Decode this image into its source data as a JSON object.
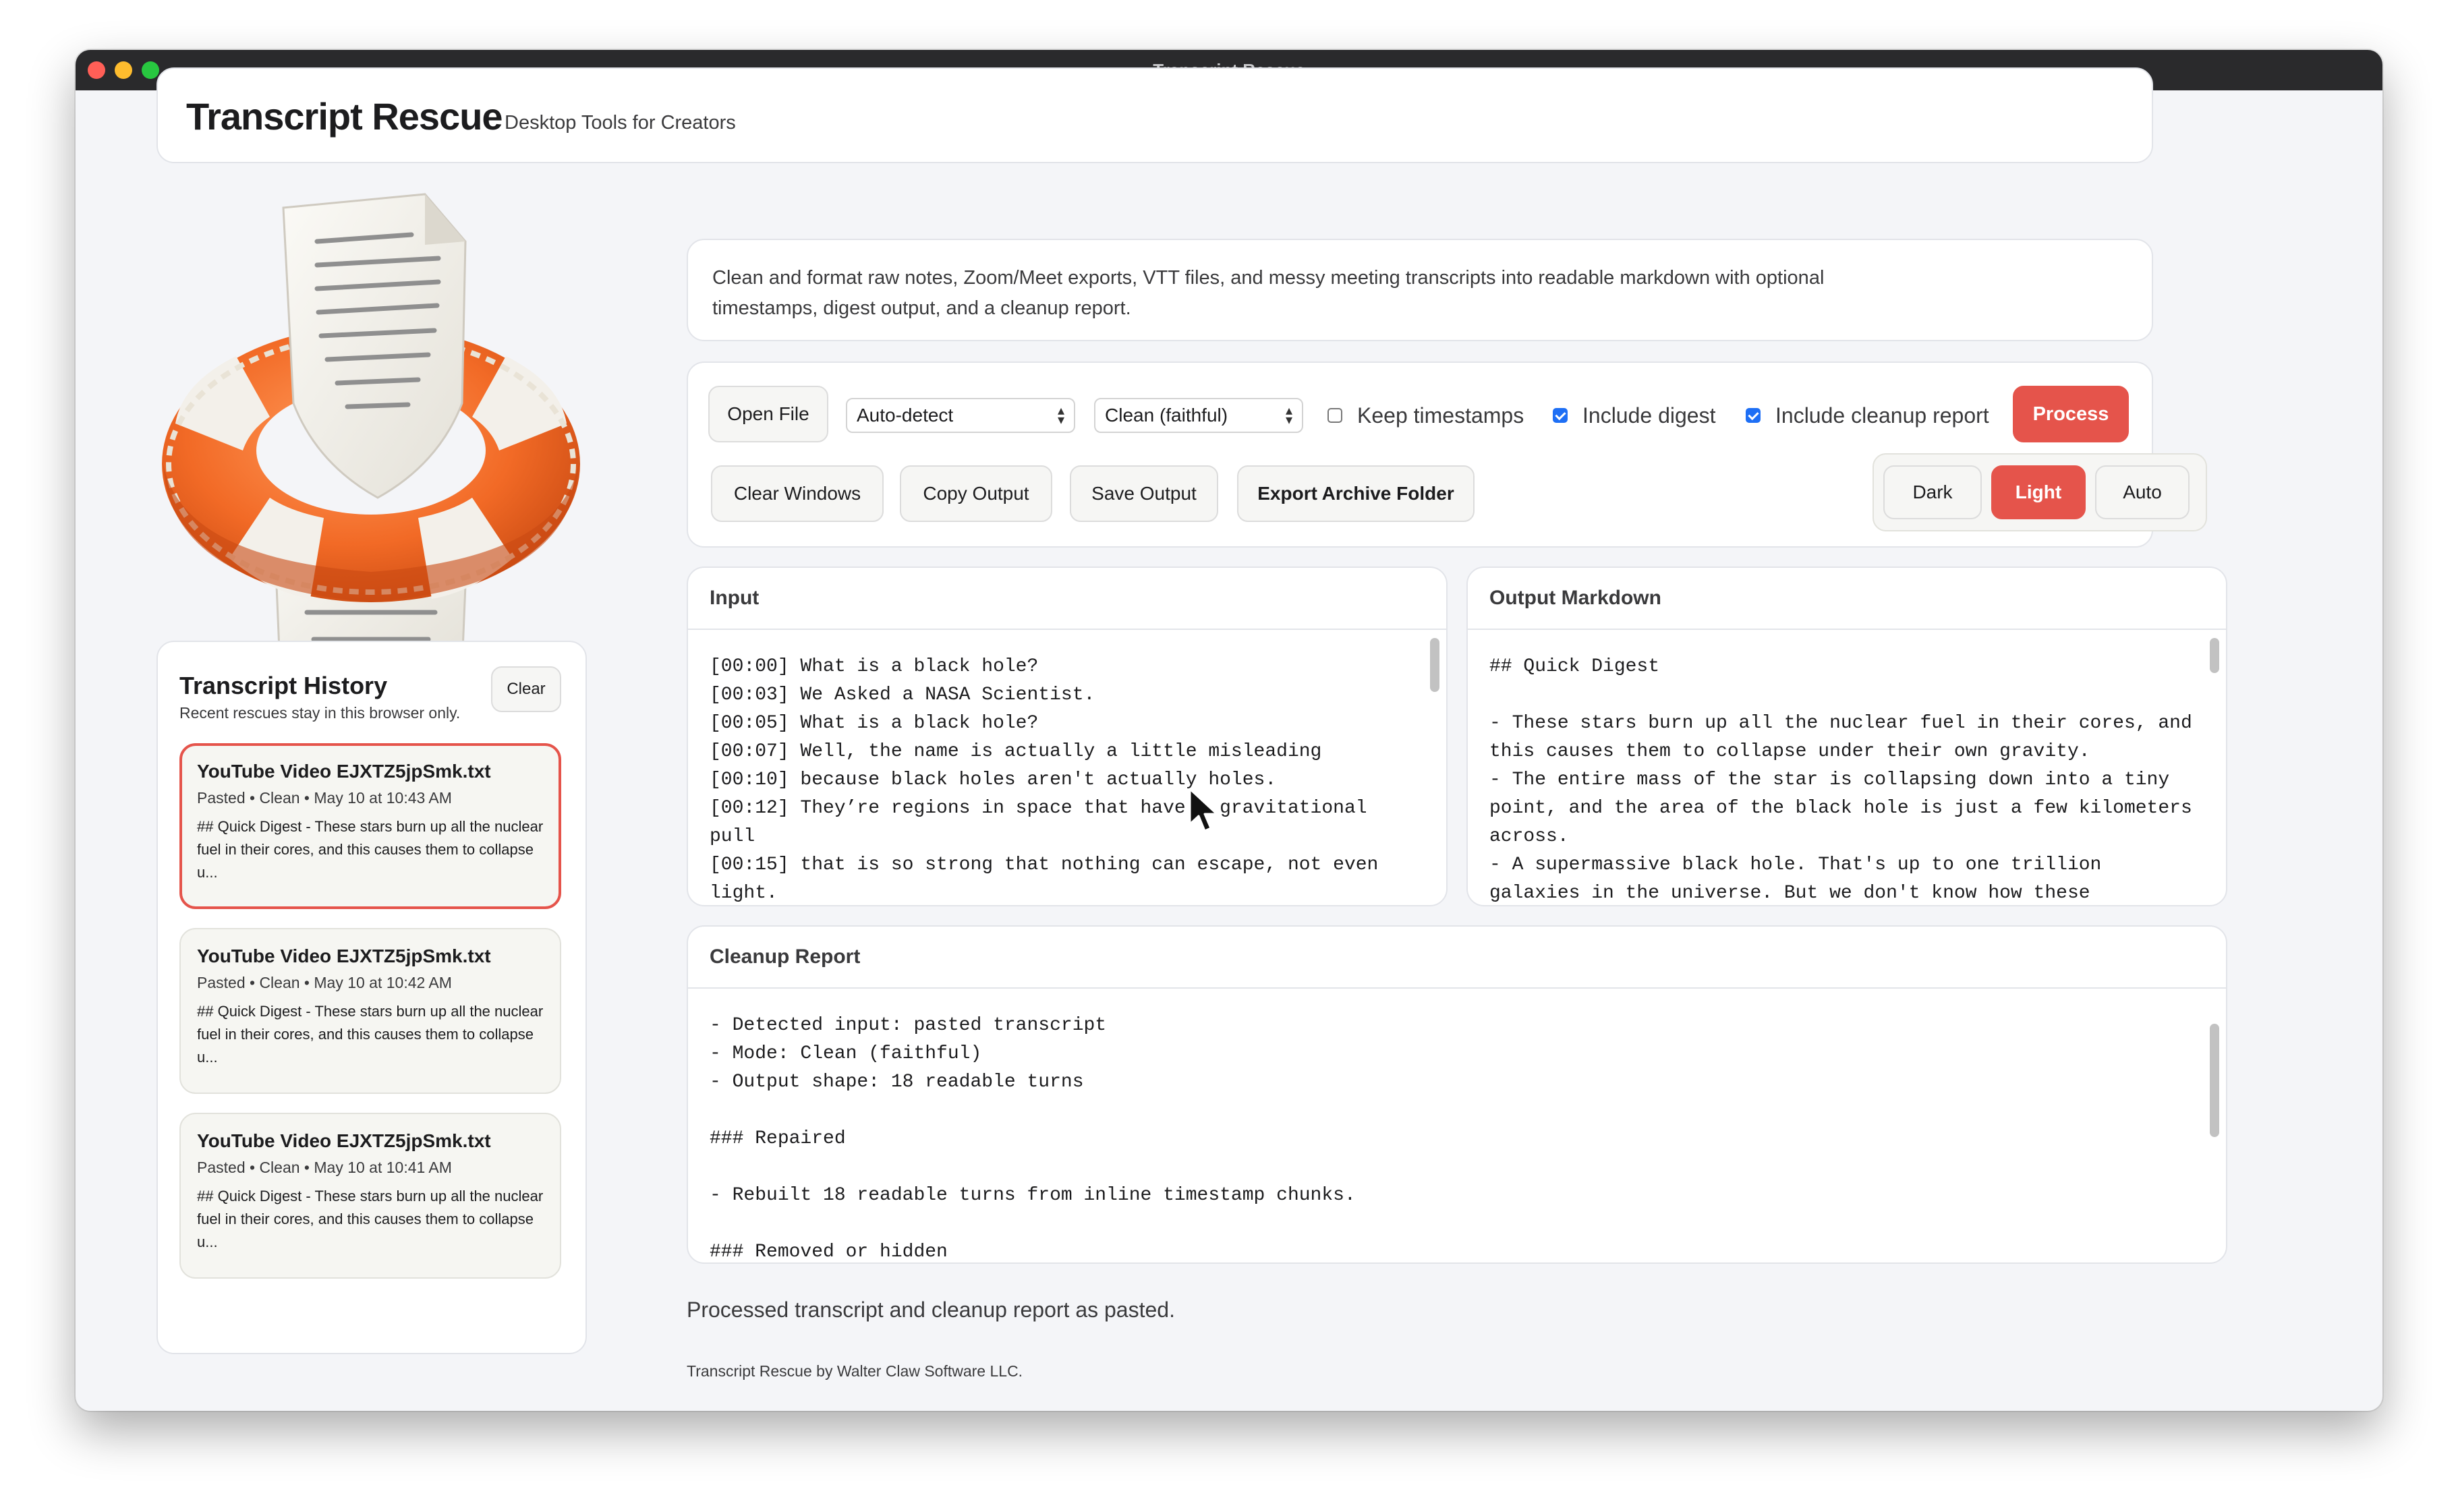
{
  "window": {
    "title": "Transcript Rescue"
  },
  "header": {
    "title": "Transcript Rescue",
    "subtitle": "Desktop Tools for Creators"
  },
  "description": "Clean and format raw notes, Zoom/Meet exports, VTT files, and messy meeting transcripts into readable markdown with optional timestamps, digest output, and a cleanup report.",
  "toolbar": {
    "open_file": "Open File",
    "format_select": "Auto-detect",
    "mode_select": "Clean (faithful)",
    "keep_timestamps": {
      "label": "Keep timestamps",
      "checked": false
    },
    "include_digest": {
      "label": "Include digest",
      "checked": true
    },
    "include_cleanup_report": {
      "label": "Include cleanup report",
      "checked": true
    },
    "process": "Process",
    "clear_windows": "Clear Windows",
    "copy_output": "Copy Output",
    "save_output": "Save Output",
    "export_archive": "Export Archive Folder",
    "theme": {
      "dark": "Dark",
      "light": "Light",
      "auto": "Auto",
      "selected": "light"
    }
  },
  "history": {
    "title": "Transcript History",
    "subtitle": "Recent rescues stay in this browser only.",
    "clear": "Clear",
    "items": [
      {
        "name": "YouTube Video EJXTZ5jpSmk.txt",
        "meta": "Pasted • Clean • May 10 at 10:43 AM",
        "snippet": "## Quick Digest - These stars burn up all the nuclear fuel in their cores, and this causes them to collapse u...",
        "active": true
      },
      {
        "name": "YouTube Video EJXTZ5jpSmk.txt",
        "meta": "Pasted • Clean • May 10 at 10:42 AM",
        "snippet": "## Quick Digest - These stars burn up all the nuclear fuel in their cores, and this causes them to collapse u...",
        "active": false
      },
      {
        "name": "YouTube Video EJXTZ5jpSmk.txt",
        "meta": "Pasted • Clean • May 10 at 10:41 AM",
        "snippet": "## Quick Digest - These stars burn up all the nuclear fuel in their cores, and this causes them to collapse u...",
        "active": false
      }
    ]
  },
  "input_panel": {
    "title": "Input",
    "text": "[00:00] What is a black hole?\n[00:03] We Asked a NASA Scientist.\n[00:05] What is a black hole?\n[00:07] Well, the name is actually a little misleading\n[00:10] because black holes aren't actually holes.\n[00:12] They’re regions in space that have a gravitational pull\n[00:15] that is so strong that nothing can escape, not even light."
  },
  "output_panel": {
    "title": "Output Markdown",
    "text": "## Quick Digest\n\n- These stars burn up all the nuclear fuel in their cores, and this causes them to collapse under their own gravity.\n- The entire mass of the star is collapsing down into a tiny point, and the area of the black hole is just a few kilometers across.\n- A supermassive black hole. That's up to one trillion galaxies in the universe. But we don't know how these"
  },
  "report_panel": {
    "title": "Cleanup Report",
    "text": "- Detected input: pasted transcript\n- Mode: Clean (faithful)\n- Output shape: 18 readable turns\n\n### Repaired\n\n- Rebuilt 18 readable turns from inline timestamp chunks.\n\n### Removed or hidden"
  },
  "status": "Processed transcript and cleanup report as pasted.",
  "footer": "Transcript Rescue by Walter Claw Software LLC.",
  "colors": {
    "accent": "#e5544b",
    "checkbox": "#1e6ff5",
    "window_bg": "#f4f5f8",
    "titlebar": "#2a2a2c"
  },
  "icons": {
    "logo": "life-ring-document-icon",
    "cursor": "mouse-pointer-icon",
    "select": "chevron-up-down-icon"
  }
}
